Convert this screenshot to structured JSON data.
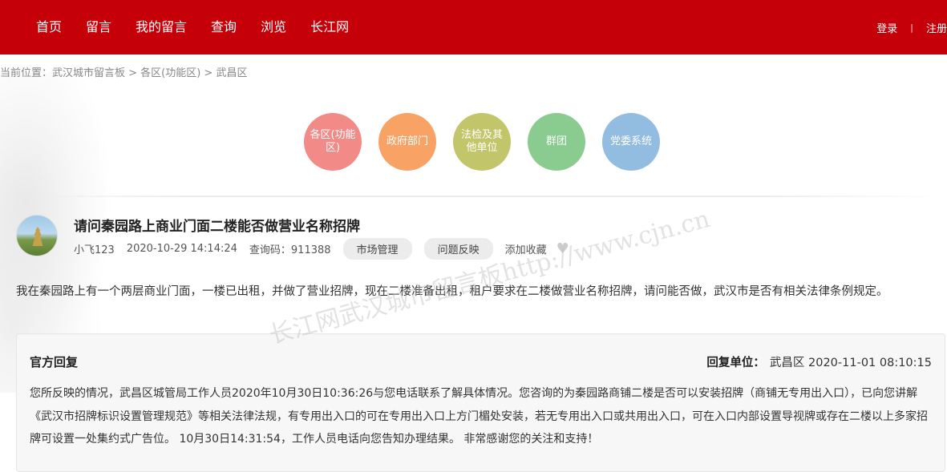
{
  "nav": {
    "items": [
      "首页",
      "留言",
      "我的留言",
      "查询",
      "浏览",
      "长江网"
    ],
    "login": "登录",
    "separator": "|",
    "register": "注册"
  },
  "breadcrumb": "当前位置：武汉城市留言板 > 各区(功能区) > 武昌区",
  "categories": [
    "各区(功能区)",
    "政府部门",
    "法检及其他单位",
    "群团",
    "党委系统"
  ],
  "question": {
    "title": "请问秦园路上商业门面二楼能否做营业名称招牌",
    "user": "小飞123",
    "time": "2020-10-29 14:14:24",
    "query_code": "查询码：911388",
    "tag1": "市场管理",
    "tag2": "问题反映",
    "favorite": "添加收藏",
    "content": "我在秦园路上有一个两层商业门面，一楼已出租，并做了营业招牌，现在二楼准备出租，租户要求在二楼做营业名称招牌，请问能否做，武汉市是否有相关法律条例规定。"
  },
  "watermark": "长江网武汉城市留言板http://www.cjn.cn",
  "reply": {
    "heading": "官方回复",
    "unit_label": "回复单位：",
    "unit_value": "武昌区 2020-11-01 08:10:15",
    "content": "您所反映的情况，武昌区城管局工作人员2020年10月30日10:36:26与您电话联系了解具体情况。您咨询的为秦园路商铺二楼是否可以安装招牌（商铺无专用出入口），已向您讲解《武汉市招牌标识设置管理规范》等相关法律法规，有专用出入口的可在专用出入口上方门楣处安装，若无专用出入口或共用出入口，可在入口内部设置导视牌或存在二楼以上多家招牌可设置一处集约式广告位。 10月30日14:31:54，工作人员电话向您告知办理结果。 非常感谢您的关注和支持！"
  },
  "colors": {
    "topbar": "#c60008",
    "circle1": "#f28b88",
    "circle2": "#f9a266",
    "circle3": "#c3c56b",
    "circle4": "#8acb8f",
    "circle5": "#92bde0"
  }
}
